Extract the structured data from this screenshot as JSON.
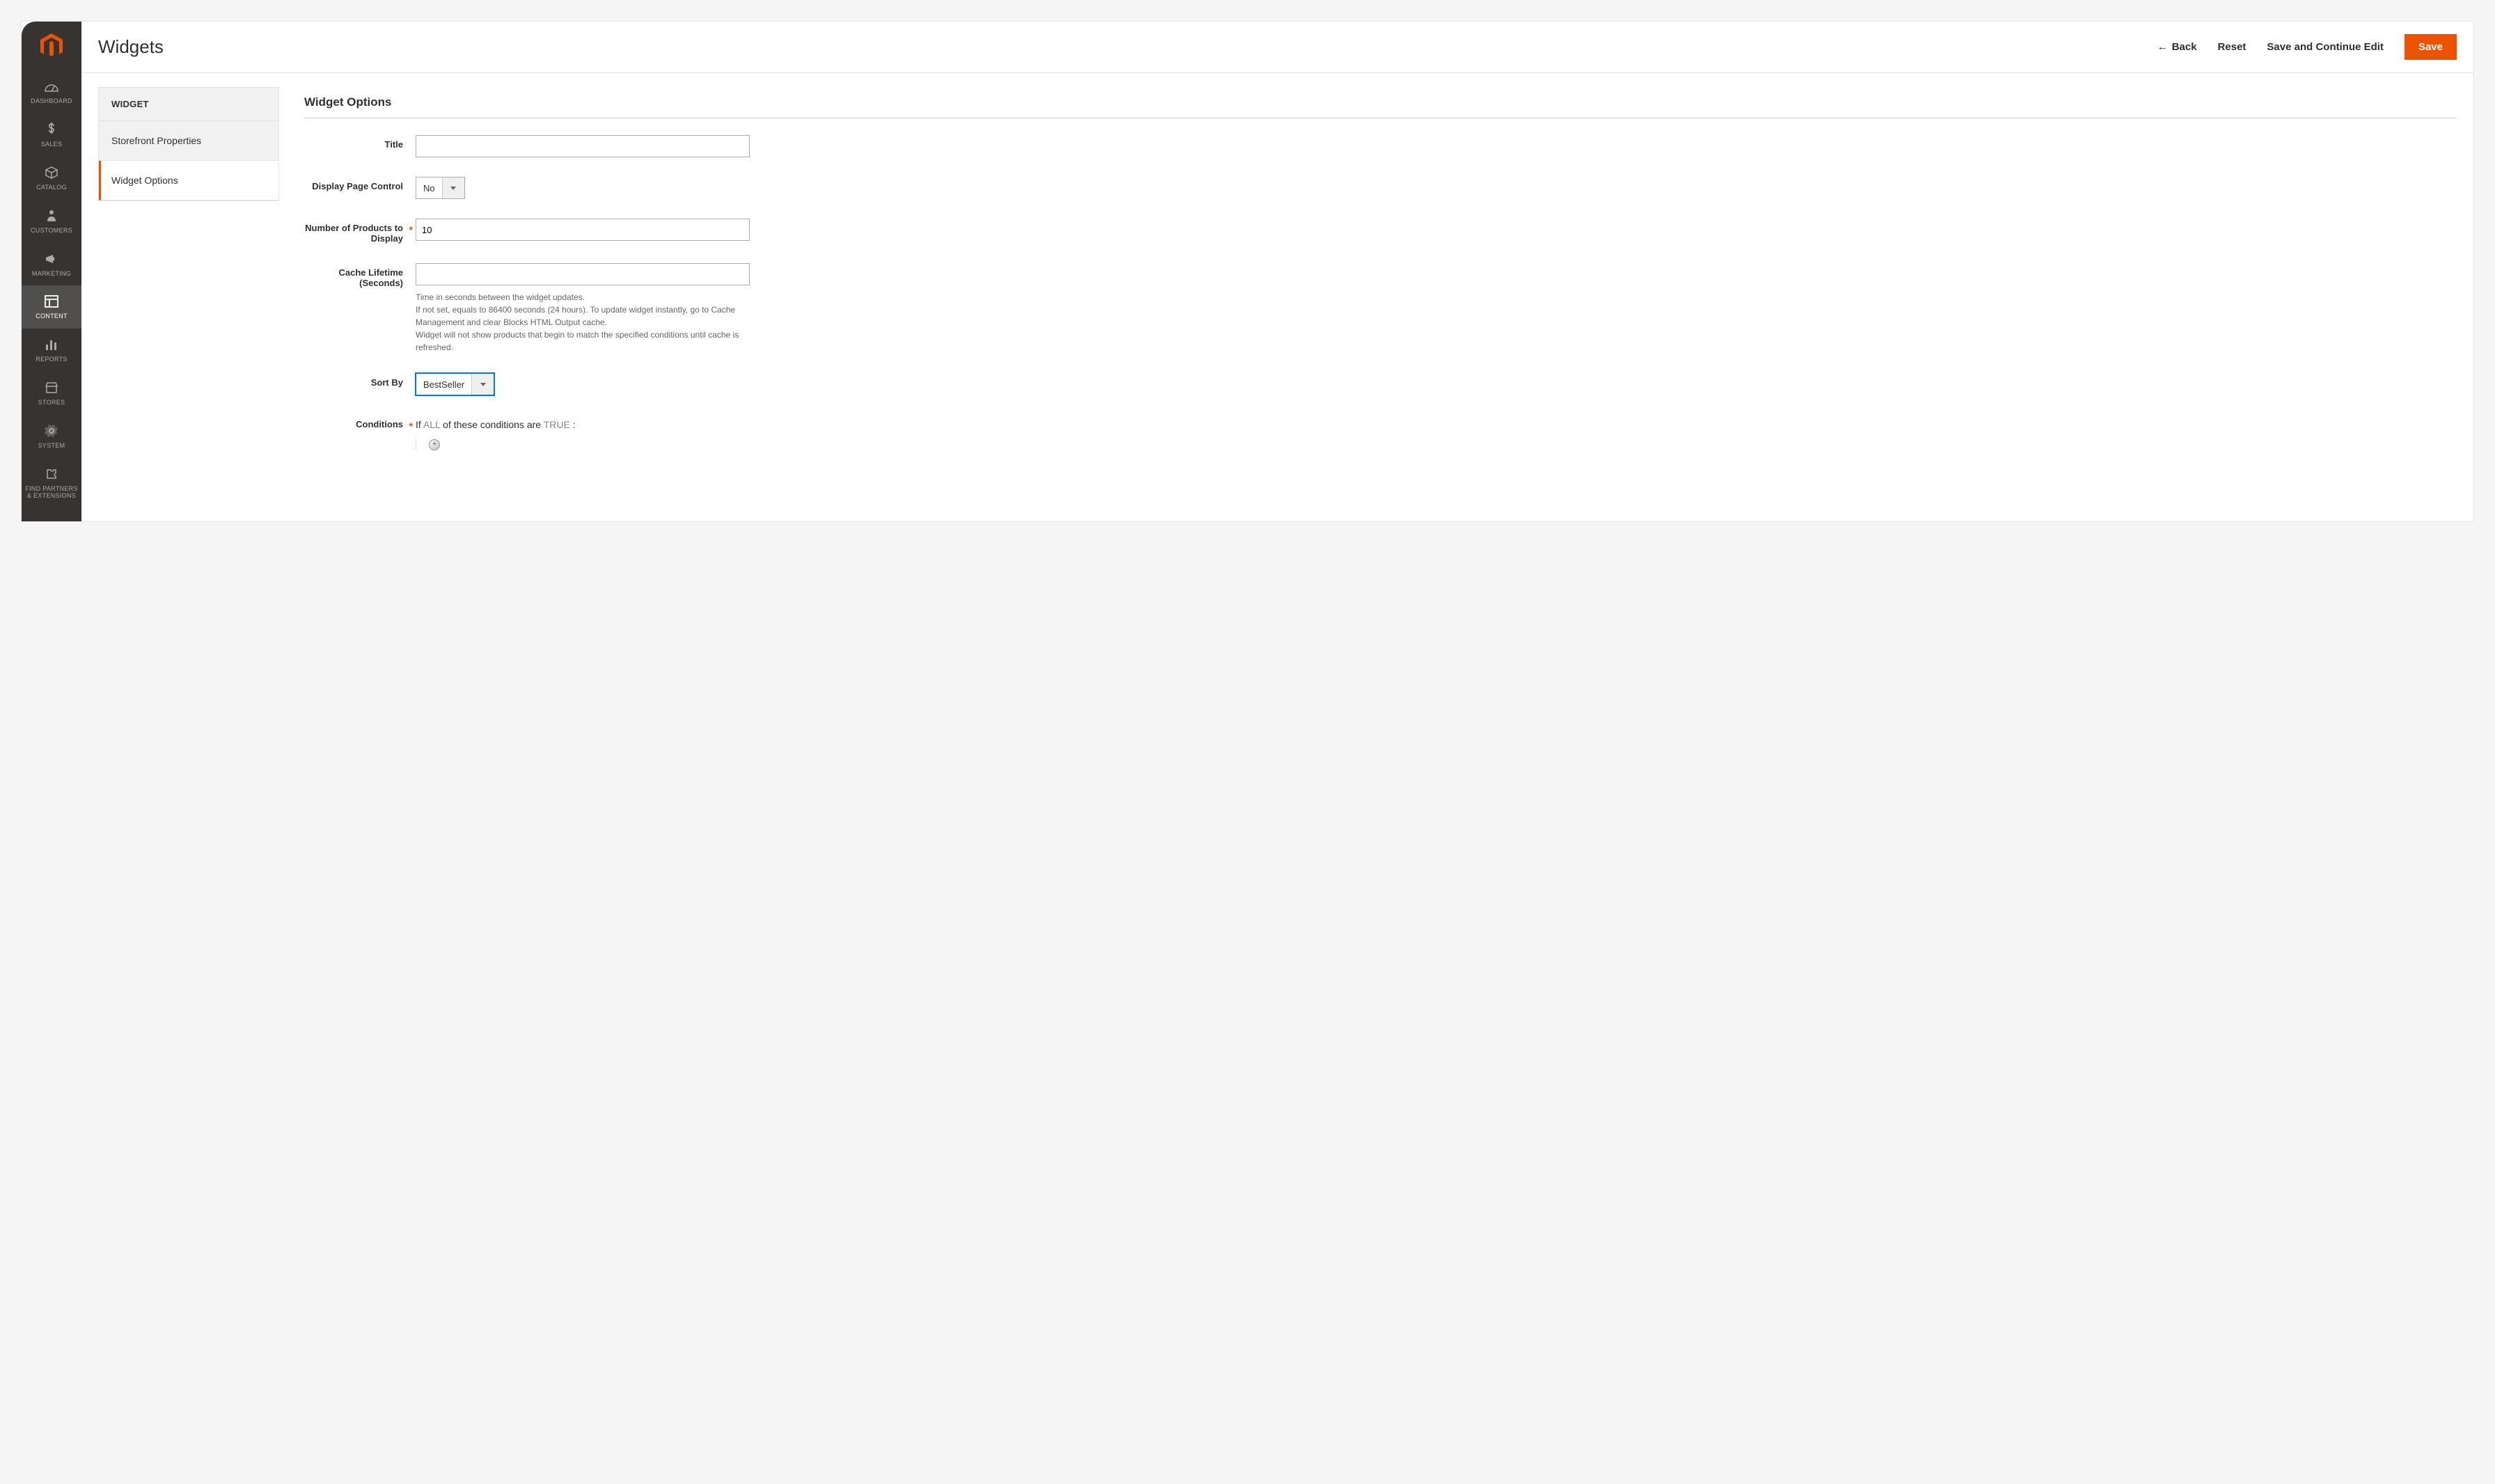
{
  "header": {
    "page_title": "Widgets",
    "back": "Back",
    "reset": "Reset",
    "save_continue": "Save and Continue Edit",
    "save": "Save"
  },
  "sidebar": {
    "items": [
      {
        "label": "DASHBOARD"
      },
      {
        "label": "SALES"
      },
      {
        "label": "CATALOG"
      },
      {
        "label": "CUSTOMERS"
      },
      {
        "label": "MARKETING"
      },
      {
        "label": "CONTENT"
      },
      {
        "label": "REPORTS"
      },
      {
        "label": "STORES"
      },
      {
        "label": "SYSTEM"
      },
      {
        "label": "FIND PARTNERS & EXTENSIONS"
      }
    ]
  },
  "tabs": {
    "title": "WIDGET",
    "items": [
      {
        "label": "Storefront Properties"
      },
      {
        "label": "Widget Options"
      }
    ]
  },
  "form": {
    "section_title": "Widget Options",
    "title_label": "Title",
    "title_value": "",
    "display_page_label": "Display Page Control",
    "display_page_value": "No",
    "num_products_label": "Number of Products to Display",
    "num_products_value": "10",
    "cache_label": "Cache Lifetime (Seconds)",
    "cache_value": "",
    "cache_hint": "Time in seconds between the widget updates.\nIf not set, equals to 86400 seconds (24 hours). To update widget instantly, go to Cache Management and clear Blocks HTML Output cache.\nWidget will not show products that begin to match the specified conditions until cache is refreshed.",
    "sort_label": "Sort By",
    "sort_value": "BestSeller",
    "conditions_label": "Conditions",
    "conditions_prefix": "If ",
    "conditions_all": "ALL",
    "conditions_mid": "  of these conditions are ",
    "conditions_true": "TRUE",
    "conditions_suffix": " :"
  }
}
